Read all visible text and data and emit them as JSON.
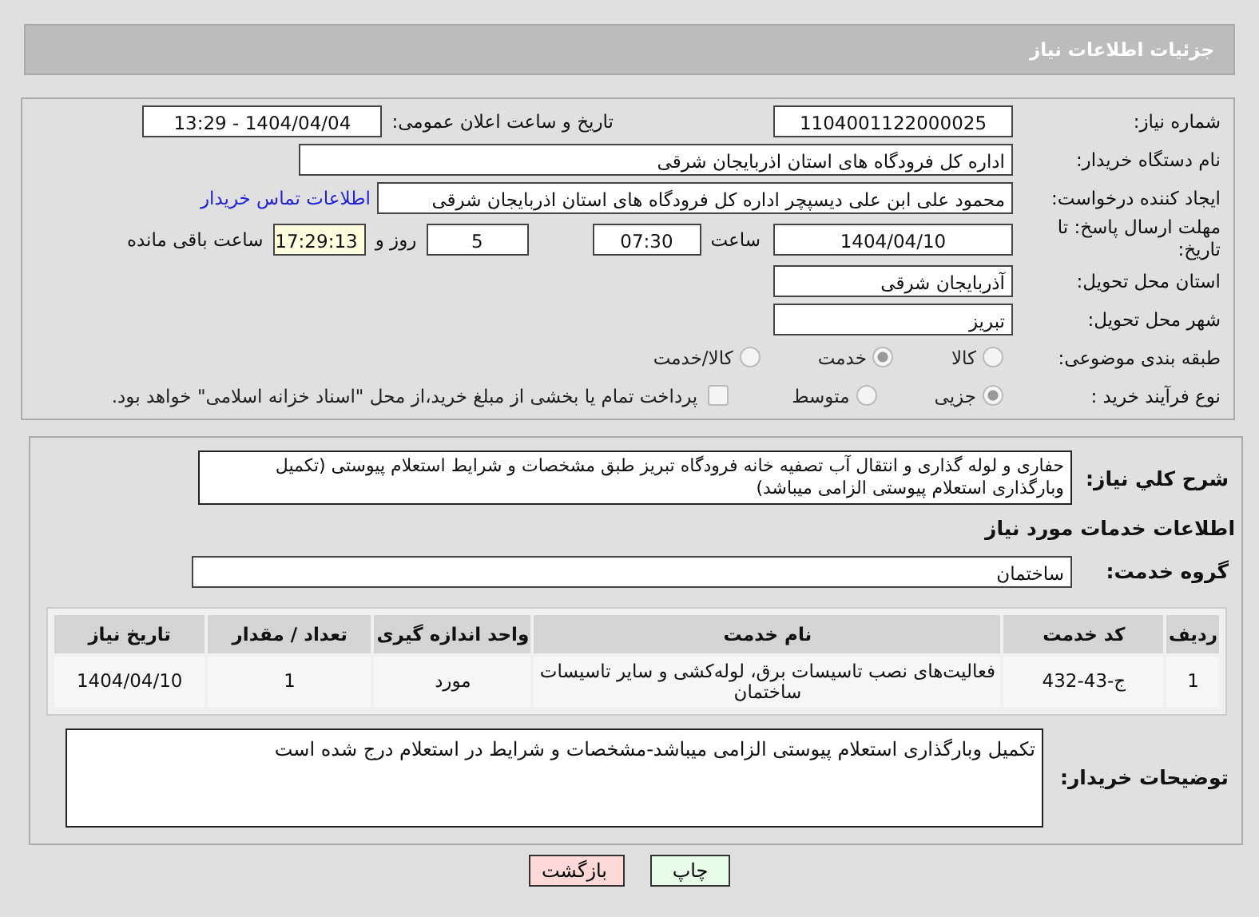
{
  "header": {
    "title": "جزئیات اطلاعات نیاز"
  },
  "need_number": {
    "label": "شماره نیاز:",
    "value": "1104001122000025"
  },
  "announce": {
    "label": "تاریخ و ساعت اعلان عمومی:",
    "value": "1404/04/04 - 13:29"
  },
  "buyer_org": {
    "label": "نام دستگاه خریدار:",
    "value": "اداره کل فرودگاه های استان اذربایجان شرقی"
  },
  "requester": {
    "label": "ایجاد کننده درخواست:",
    "value": "محمود علی ابن علی دیسپچر اداره کل فرودگاه های استان اذربایجان شرقی",
    "link": "اطلاعات تماس خریدار"
  },
  "deadline": {
    "label": "مهلت ارسال پاسخ: تا تاریخ:",
    "date": "1404/04/10",
    "time_label": "ساعت",
    "time": "07:30",
    "days": "5",
    "days_label": "روز و",
    "remaining": "17:29:13",
    "remaining_label": "ساعت باقی مانده"
  },
  "province": {
    "label": "استان محل تحویل:",
    "value": "آذربایجان شرقی"
  },
  "city": {
    "label": "شهر محل تحویل:",
    "value": "تبریز"
  },
  "category": {
    "label": "طبقه بندی موضوعی:",
    "options": [
      {
        "label": "کالا",
        "selected": false
      },
      {
        "label": "خدمت",
        "selected": true
      },
      {
        "label": "کالا/خدمت",
        "selected": false
      }
    ]
  },
  "process": {
    "label": "نوع فرآیند خرید :",
    "options": [
      {
        "label": "جزیی",
        "selected": true
      },
      {
        "label": "متوسط",
        "selected": false
      }
    ],
    "checkbox": {
      "label": "پرداخت تمام یا بخشی از مبلغ خرید،از محل \"اسناد خزانه اسلامی\" خواهد بود.",
      "checked": false
    }
  },
  "description": {
    "label": "شرح کلي نياز:",
    "value": "حفاری و لوله گذاری و انتقال آب تصفیه خانه فرودگاه تبریز طبق مشخصات و شرایط استعلام پیوستی (تکمیل وبارگذاری استعلام پیوستی الزامی میباشد)"
  },
  "services_heading": "اطلاعات خدمات مورد نیاز",
  "service_group": {
    "label": "گروه خدمت:",
    "value": "ساختمان"
  },
  "table": {
    "columns": [
      "ردیف",
      "کد خدمت",
      "نام خدمت",
      "واحد اندازه گیری",
      "تعداد / مقدار",
      "تاریخ نیاز"
    ],
    "rows": [
      [
        "1",
        "ج-43-432",
        "فعالیت‌های نصب تاسیسات برق، لوله‌کشی و سایر تاسیسات ساختمان",
        "مورد",
        "1",
        "1404/04/10"
      ]
    ]
  },
  "buyer_notes": {
    "label": "توضیحات خریدار:",
    "value": "تکمیل وبارگذاری استعلام پیوستی الزامی میباشد-مشخصات و شرایط در استعلام درج شده است"
  },
  "buttons": [
    {
      "label": "چاپ",
      "kind": "print"
    },
    {
      "label": "بازگشت",
      "kind": "back"
    }
  ]
}
